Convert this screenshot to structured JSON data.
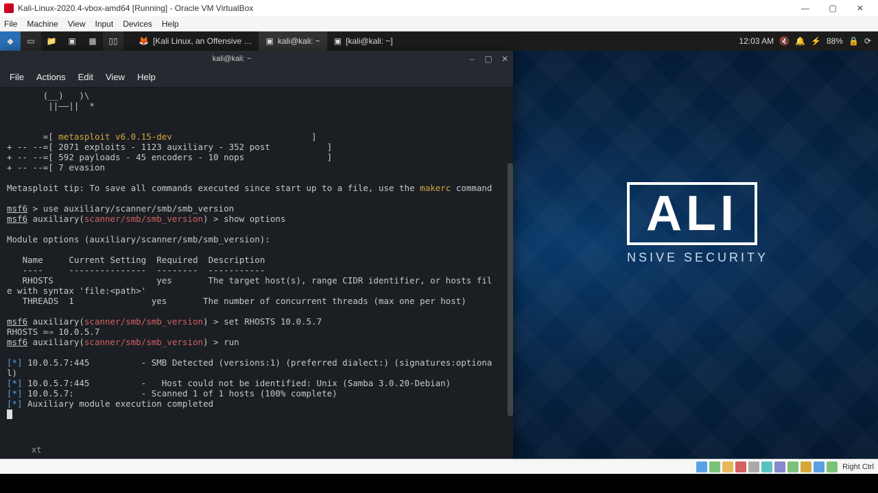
{
  "vb": {
    "title": "Kali-Linux-2020.4-vbox-amd64 [Running] - Oracle VM VirtualBox",
    "menu": [
      "File",
      "Machine",
      "View",
      "Input",
      "Devices",
      "Help"
    ],
    "min": "—",
    "max": "▢",
    "close": "✕",
    "status_right": "Right Ctrl"
  },
  "panel": {
    "tasks": [
      {
        "icon": "🦊",
        "label": "[Kali Linux, an Offensive …"
      },
      {
        "icon": "▣",
        "label": "kali@kali: ~",
        "active": true
      },
      {
        "icon": "▣",
        "label": "[kali@kali: ~]"
      }
    ],
    "clock": "12:03 AM",
    "battery": "88%",
    "tray_icons": [
      "🔇",
      "🔔",
      "⚡",
      "🔒",
      "⟳"
    ]
  },
  "desktop": {
    "logo_text": "ALI",
    "logo_tag": "NSIVE SECURITY"
  },
  "term": {
    "title": "kali@kali: ~",
    "menu": [
      "File",
      "Actions",
      "Edit",
      "View",
      "Help"
    ],
    "min": "–",
    "max": "▢",
    "close": "✕",
    "foot": "xt",
    "ascii1": "       (__)   )\\",
    "ascii2": "        ||——||  *",
    "banner_brand": "metasploit v6.0.15-dev",
    "banner_pre1": "       =[ ",
    "banner_post": "                           ]",
    "stats1_pre": "+ -- --=[ ",
    "stats1": "2071 exploits - 1123 auxiliary - 352 post",
    "stats2": "592 payloads - 45 encoders - 10 nops",
    "stats3": "7 evasion",
    "tip_pre": "Metasploit tip: To save all commands executed since start up to a file, use the ",
    "tip_cmd": "makerc",
    "tip_post": " command",
    "msf": "msf6",
    "aux_open": " auxiliary(",
    "module_red": "scanner/smb/smb_version",
    "aux_close_prompt": ") > ",
    "cmd1": "use auxiliary/scanner/smb/smb_version",
    "cmd2": "show options",
    "mod_opts_header": "Module options (auxiliary/scanner/smb/smb_version):",
    "col_name": "Name",
    "col_cur": "Current Setting",
    "col_req": "Required",
    "col_desc": "Description",
    "col_dash_name": "----",
    "col_dash_cur": "---------------",
    "col_dash_req": "--------",
    "col_dash_desc": "-----------",
    "row_rhosts": "   RHOSTS                    yes       The target host(s), range CIDR identifier, or hosts fil",
    "row_rhosts2": "e with syntax 'file:<path>'",
    "row_threads": "   THREADS  1               yes       The number of concurrent threads (max one per host)",
    "cmd3": "set RHOSTS 10.0.5.7",
    "set_echo": "RHOSTS =⇒ 10.0.5.7",
    "cmd4": "run",
    "star": "[*]",
    "res1": " 10.0.5.7:445          - SMB Detected (versions:1) (preferred dialect:) (signatures:optiona",
    "res1b": "l)",
    "res2": " 10.0.5.7:445          -   Host could not be identified: Unix (Samba 3.0.20-Debian)",
    "res3": " 10.0.5.7:             - Scanned 1 of 1 hosts (100% complete)",
    "res4": " Auxiliary module execution completed"
  }
}
